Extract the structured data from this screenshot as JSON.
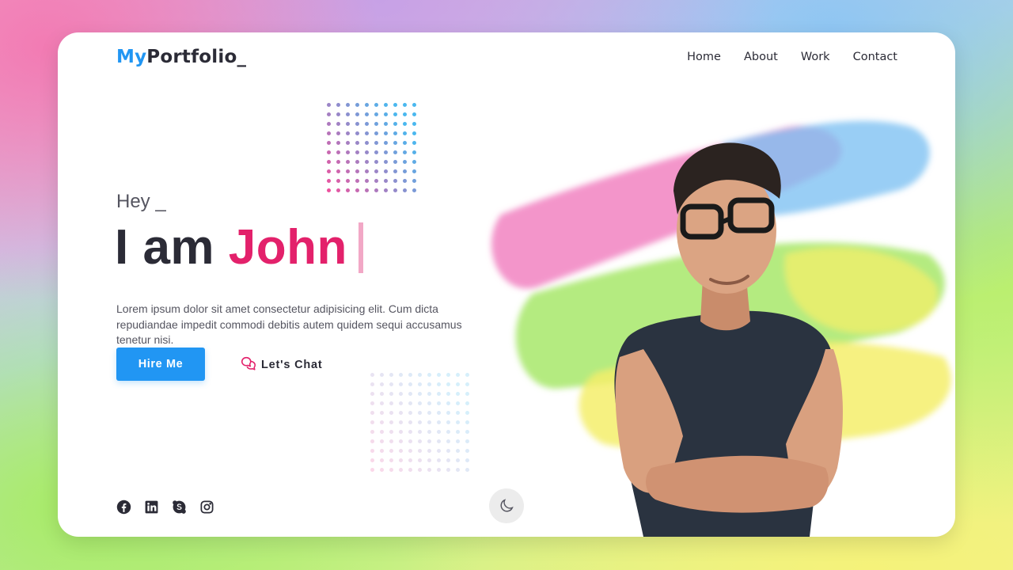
{
  "header": {
    "logo_prefix": "My",
    "logo_suffix": "Portfolio_",
    "nav": [
      "Home",
      "About",
      "Work",
      "Contact"
    ]
  },
  "hero": {
    "greeting": "Hey _",
    "headline_prefix": "I am ",
    "headline_name": "John",
    "description": "Lorem ipsum dolor sit amet consectetur adipisicing elit. Cum dicta repudiandae impedit commodi debitis autem quidem sequi accusamus tenetur nisi.",
    "primary_button": "Hire Me",
    "secondary_button": "Let's Chat"
  },
  "socials": [
    "facebook-icon",
    "linkedin-icon",
    "skype-icon",
    "instagram-icon"
  ],
  "theme_toggle_icon": "moon-icon",
  "colors": {
    "accent_blue": "#2196f3",
    "accent_pink": "#e3216b",
    "text_dark": "#2b2b36"
  }
}
